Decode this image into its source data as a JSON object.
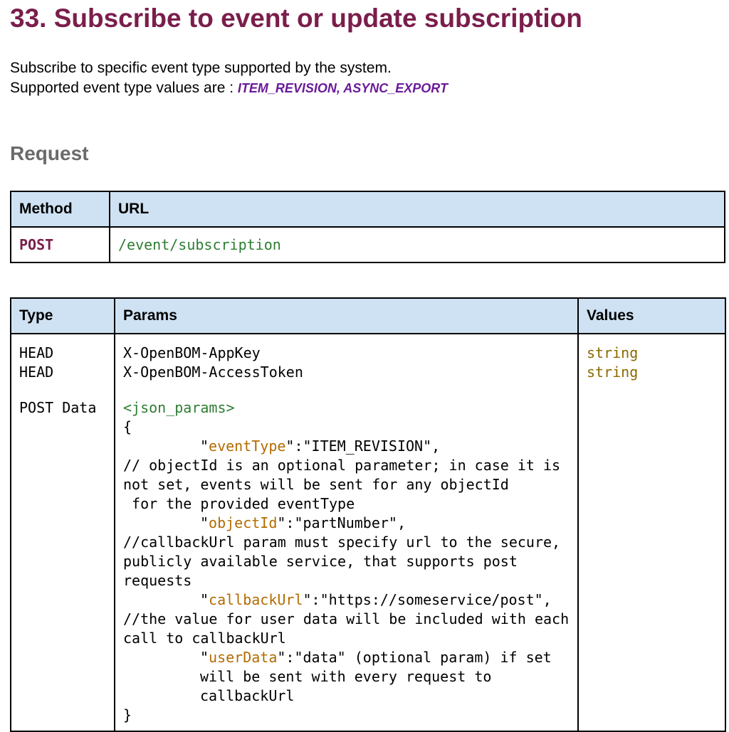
{
  "header": {
    "title": "33. Subscribe to event or update subscription"
  },
  "intro": {
    "line1": "Subscribe to specific event type supported by the system.",
    "line2_prefix": "Supported event type values are : ",
    "event_types": "ITEM_REVISION, ASYNC_EXPORT"
  },
  "request": {
    "heading": "Request",
    "method_table": {
      "headers": [
        "Method",
        "URL"
      ],
      "method": "POST",
      "url": "/event/subscription"
    },
    "params_table": {
      "headers": [
        "Type",
        "Params",
        "Values"
      ],
      "rows": [
        {
          "type": "HEAD",
          "param": "X-OpenBOM-AppKey",
          "value": "string"
        },
        {
          "type": "HEAD",
          "param": "X-OpenBOM-AccessToken",
          "value": "string"
        }
      ],
      "post_data": {
        "type": "POST Data",
        "label": "<json_params>",
        "open_brace": "{",
        "close_brace": "}",
        "event_type_quote_open": "\"",
        "event_type_key": "eventType",
        "event_type_rest": "\":\"ITEM_REVISION\",",
        "comment_object_id": "// objectId is an optional parameter; in case it is not set, events will be sent for any objectId",
        "comment_object_id_cont": " for the provided eventType",
        "object_id_quote_open": "\"",
        "object_id_key": "objectId",
        "object_id_rest": "\":\"partNumber\",",
        "comment_callback": "//callbackUrl param must specify url to the secure, publicly available service, that supports post requests",
        "callback_quote_open": "\"",
        "callback_key": "callbackUrl",
        "callback_rest": "\":\"https://someservice/post\",",
        "comment_user_data": "//the value for user data will be included with each call to callbackUrl",
        "user_data_quote_open": "\"",
        "user_data_key": "userData",
        "user_data_rest": "\":\"data\" (optional param) if set will be sent with every request to callbackUrl"
      }
    }
  }
}
